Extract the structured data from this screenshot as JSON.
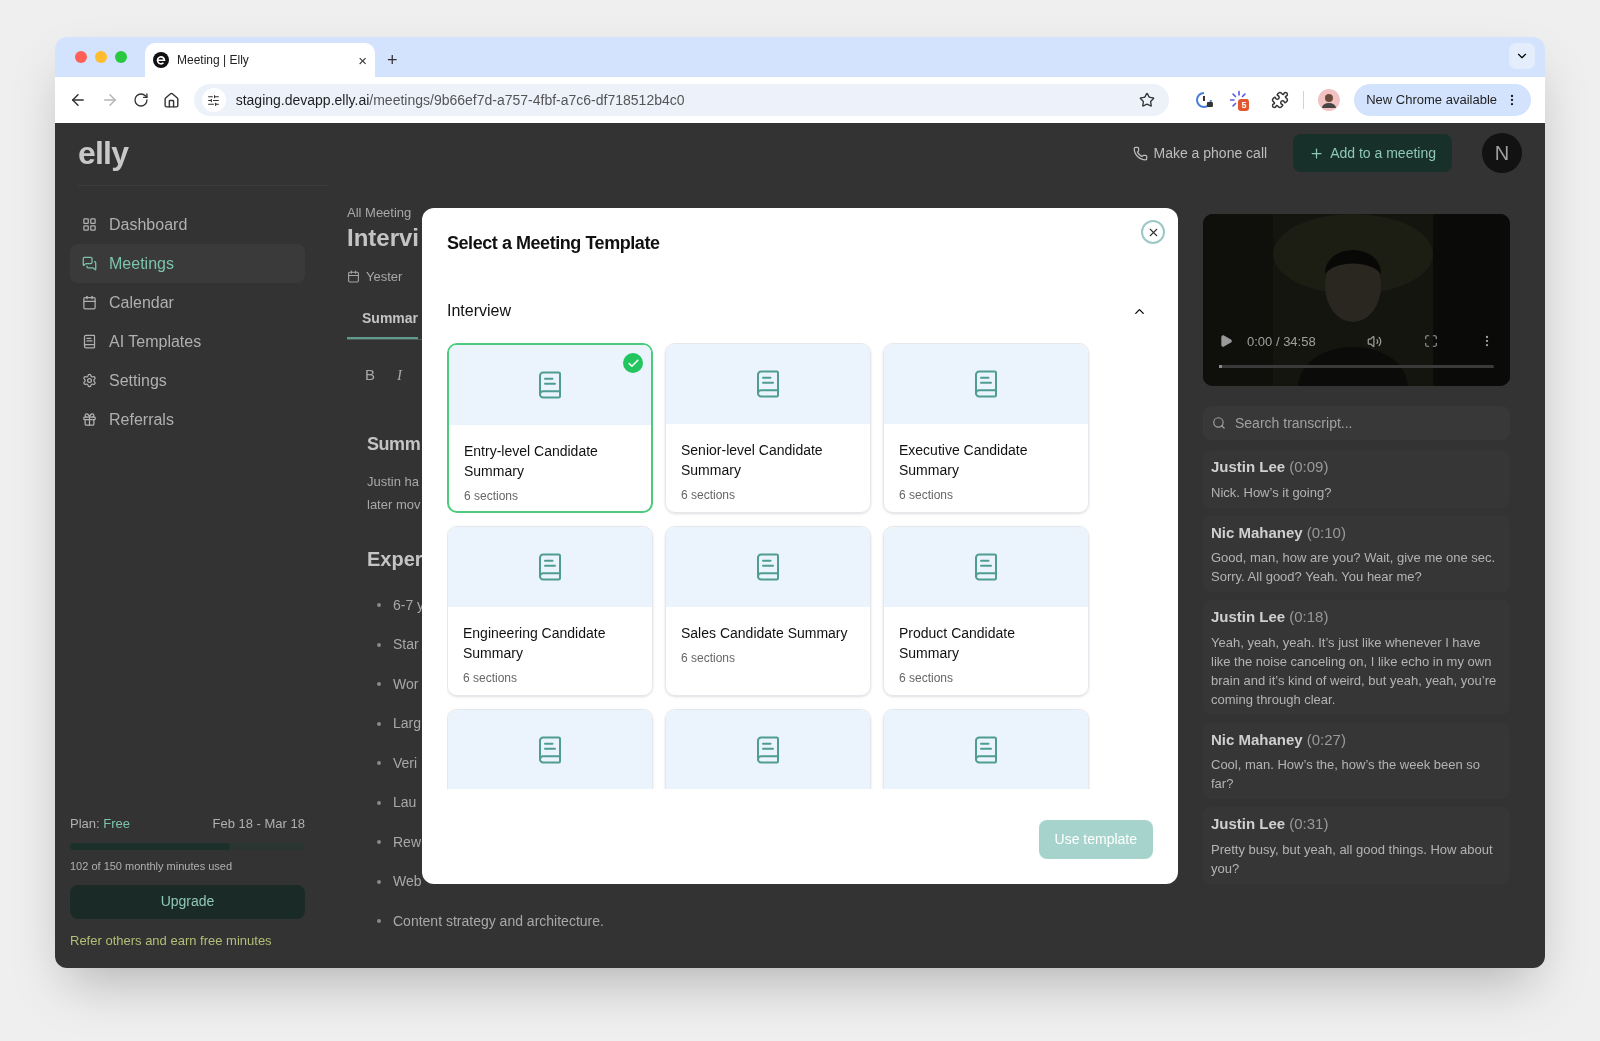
{
  "browser": {
    "tab": {
      "title": "Meeting | Elly",
      "close": "×"
    },
    "new_tab": "+",
    "forward_disabled": true,
    "url": {
      "host": "staging.devapp.elly.ai",
      "path": "/meetings/9b66ef7d-a757-4fbf-a7c6-df718512b4c0"
    },
    "extension_badge": "5",
    "update_button": "New Chrome available"
  },
  "header": {
    "logo": "elly",
    "phone_call": "Make a phone call",
    "add_button": "Add to a meeting",
    "avatar": "N"
  },
  "sidebar": {
    "items": [
      {
        "label": "Dashboard",
        "kind": "dashboard",
        "selected": false
      },
      {
        "label": "Meetings",
        "kind": "meetings",
        "selected": true
      },
      {
        "label": "Calendar",
        "kind": "calendar",
        "selected": false
      },
      {
        "label": "AI Templates",
        "kind": "templates",
        "selected": false
      },
      {
        "label": "Settings",
        "kind": "settings",
        "selected": false
      },
      {
        "label": "Referrals",
        "kind": "referrals",
        "selected": false
      }
    ],
    "plan": {
      "label": "Plan:",
      "tier": "Free",
      "period": "Feb 18 - Mar 18",
      "level": 0.68,
      "usage": "102 of 150 monthly minutes used",
      "upgrade": "Upgrade",
      "referral": "Refer others and earn free minutes"
    }
  },
  "meeting": {
    "breadcrumb": "All Meeting",
    "title": "Intervi",
    "date": "Yester",
    "tabs": [
      {
        "label": "Summar",
        "selected": true
      }
    ],
    "toolbar": [
      {
        "label": "B",
        "kind": "bold"
      },
      {
        "label": "I",
        "kind": "italic"
      }
    ],
    "summary_heading": "Summ",
    "summary_lines": [
      "Justin ha",
      "later mov"
    ],
    "experience_heading": "Exper",
    "bullets": [
      "6-7 y",
      "Star",
      "Wor",
      "Larg",
      "Veri",
      "Lau",
      "Rew",
      "Web",
      "Content strategy and architecture."
    ]
  },
  "video": {
    "time": "0:00 / 34:58",
    "level": 0.01
  },
  "transcript": {
    "search_placeholder": "Search transcript...",
    "entries": [
      {
        "speaker": "Justin Lee",
        "time": "(0:09)",
        "text": "Nick. How’s it going?"
      },
      {
        "speaker": "Nic Mahaney",
        "time": "(0:10)",
        "text": "Good, man, how are you? Wait, give me one sec. Sorry. All good? Yeah. You hear me?"
      },
      {
        "speaker": "Justin Lee",
        "time": "(0:18)",
        "text": "Yeah, yeah, yeah. It’s just like whenever I have like the noise canceling on, I like echo in my own brain and it’s kind of weird, but yeah, yeah, you’re coming through clear."
      },
      {
        "speaker": "Nic Mahaney",
        "time": "(0:27)",
        "text": "Cool, man. How’s the, how’s the week been so far?"
      },
      {
        "speaker": "Justin Lee",
        "time": "(0:31)",
        "text": "Pretty busy, but yeah, all good things. How about you?"
      }
    ]
  },
  "modal": {
    "title": "Select a Meeting Template",
    "section": {
      "title": "Interview",
      "expanded": true
    },
    "templates": [
      {
        "title": "Entry-level Candidate Summary",
        "sections": "6 sections",
        "selected": true
      },
      {
        "title": "Senior-level Candidate Summary",
        "sections": "6 sections",
        "selected": false
      },
      {
        "title": "Executive Candidate Summary",
        "sections": "6 sections",
        "selected": false
      },
      {
        "title": "Engineering Candidate Summary",
        "sections": "6 sections",
        "selected": false
      },
      {
        "title": "Sales Candidate Summary",
        "sections": "6 sections",
        "selected": false
      },
      {
        "title": "Product Candidate Summary",
        "sections": "6 sections",
        "selected": false
      },
      {
        "selected": false
      },
      {
        "selected": false
      },
      {
        "selected": false
      }
    ],
    "use_button": {
      "label": "Use template",
      "disabled": true
    }
  }
}
